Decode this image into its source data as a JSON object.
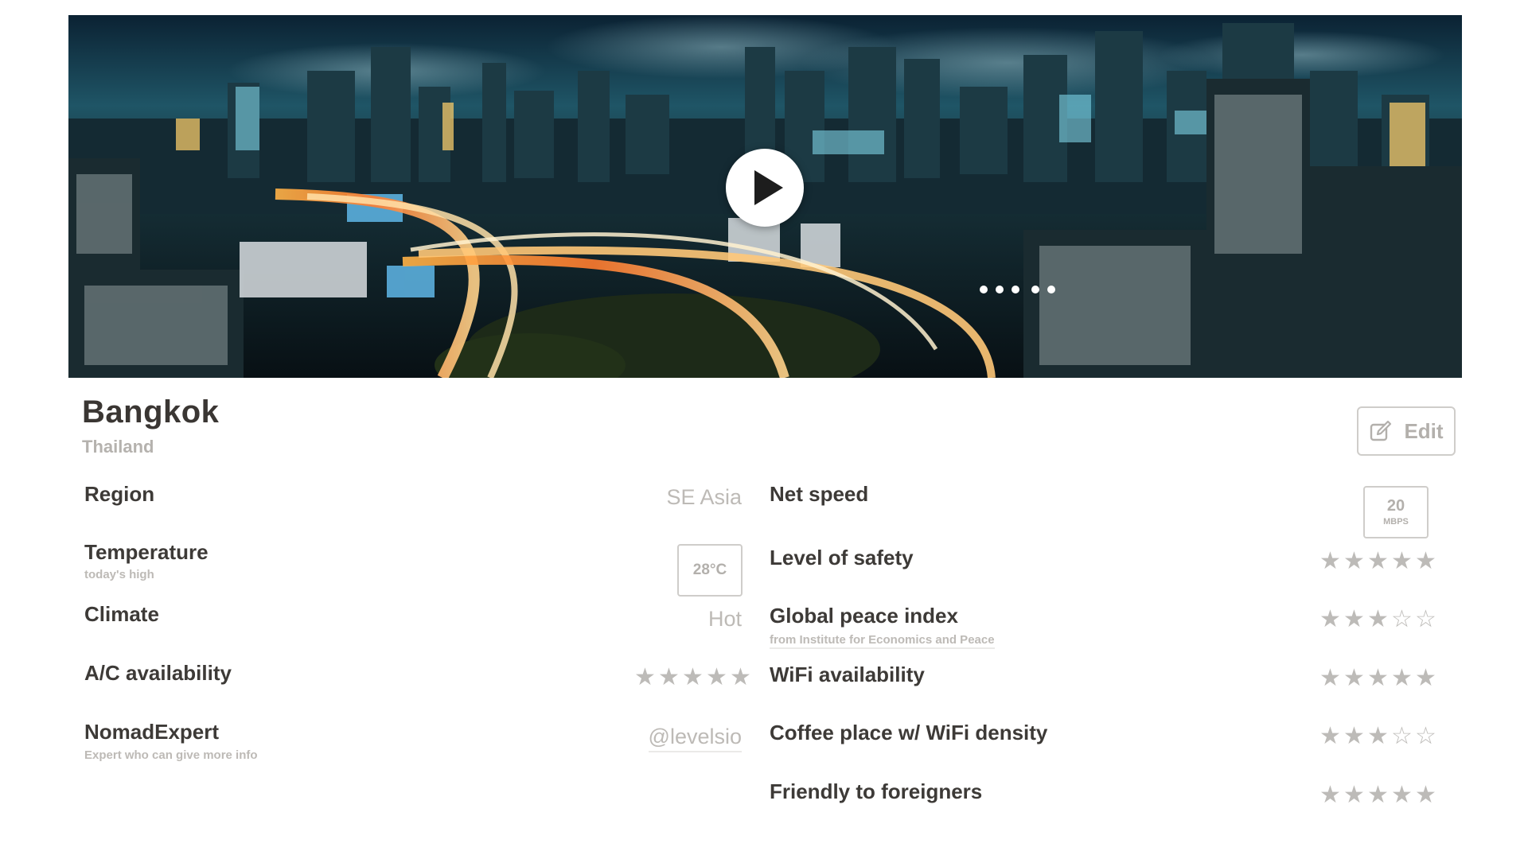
{
  "hero": {
    "play_icon": "play-icon"
  },
  "header": {
    "city": "Bangkok",
    "country": "Thailand",
    "edit_label": "Edit",
    "edit_icon": "edit-icon"
  },
  "left_rows": {
    "region": {
      "label": "Region",
      "value": "SE Asia"
    },
    "temperature": {
      "label": "Temperature",
      "sublabel": "today's high",
      "value": "28°C"
    },
    "climate": {
      "label": "Climate",
      "value": "Hot"
    },
    "ac": {
      "label": "A/C availability",
      "rating": 5,
      "max": 5
    },
    "expert": {
      "label": "NomadExpert",
      "sublabel": "Expert who can give more info",
      "value": "@levelsio"
    }
  },
  "right_rows": {
    "net_speed": {
      "label": "Net speed",
      "value": "20",
      "unit": "MBPS"
    },
    "safety": {
      "label": "Level of safety",
      "rating": 5,
      "max": 5
    },
    "peace": {
      "label": "Global peace index",
      "sublabel": "from Institute for Economics and Peace",
      "rating": 3,
      "max": 5
    },
    "wifi": {
      "label": "WiFi availability",
      "rating": 5,
      "max": 5
    },
    "coffee": {
      "label": "Coffee place w/ WiFi density",
      "rating": 3,
      "max": 5
    },
    "friendly": {
      "label": "Friendly to foreigners",
      "rating": 5,
      "max": 5
    }
  },
  "colors": {
    "label": "#3d3a37",
    "muted": "#bdbab6",
    "star": "#bdbbb8",
    "border": "#cfcdca"
  }
}
